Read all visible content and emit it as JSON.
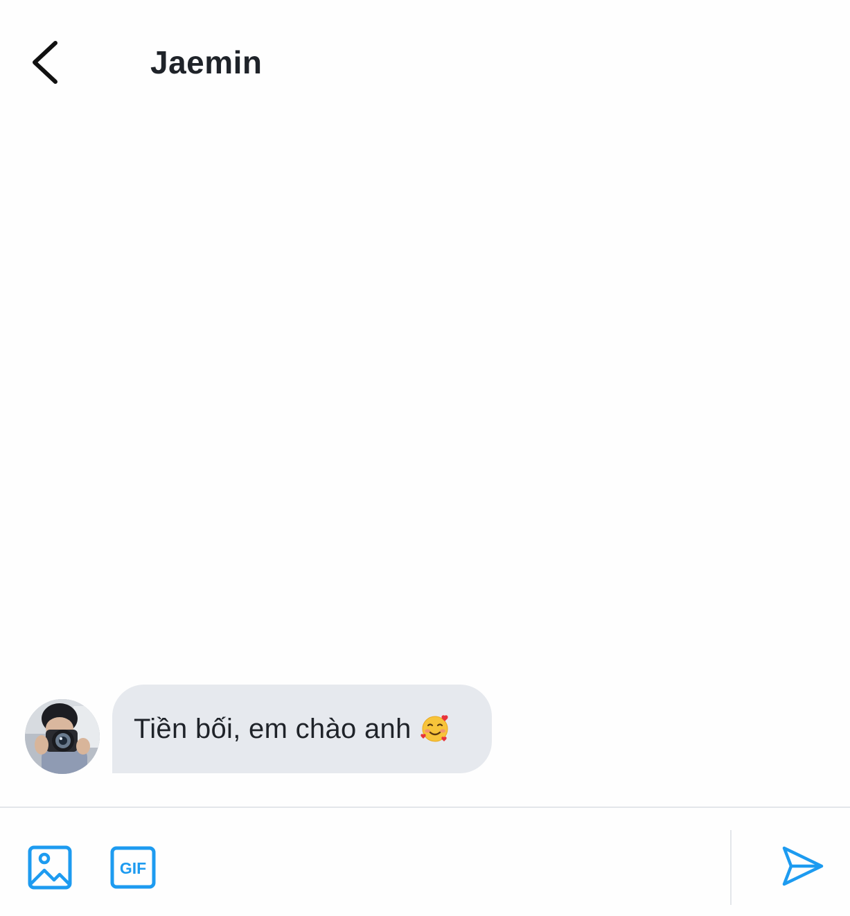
{
  "header": {
    "title": "Jaemin",
    "back_icon": "chevron-left-icon"
  },
  "messages": [
    {
      "sender": "Jaemin",
      "text": "Tiền bối, em chào anh",
      "emoji": "smiling-face-with-hearts"
    }
  ],
  "composer": {
    "placeholder": "",
    "value": "",
    "image_icon": "image-icon",
    "gif_label": "GIF",
    "send_icon": "send-icon"
  },
  "colors": {
    "accent": "#1d9bf0",
    "bubble_bg": "#e6e9ee",
    "text": "#1f2329",
    "divider": "#e3e6ea"
  }
}
